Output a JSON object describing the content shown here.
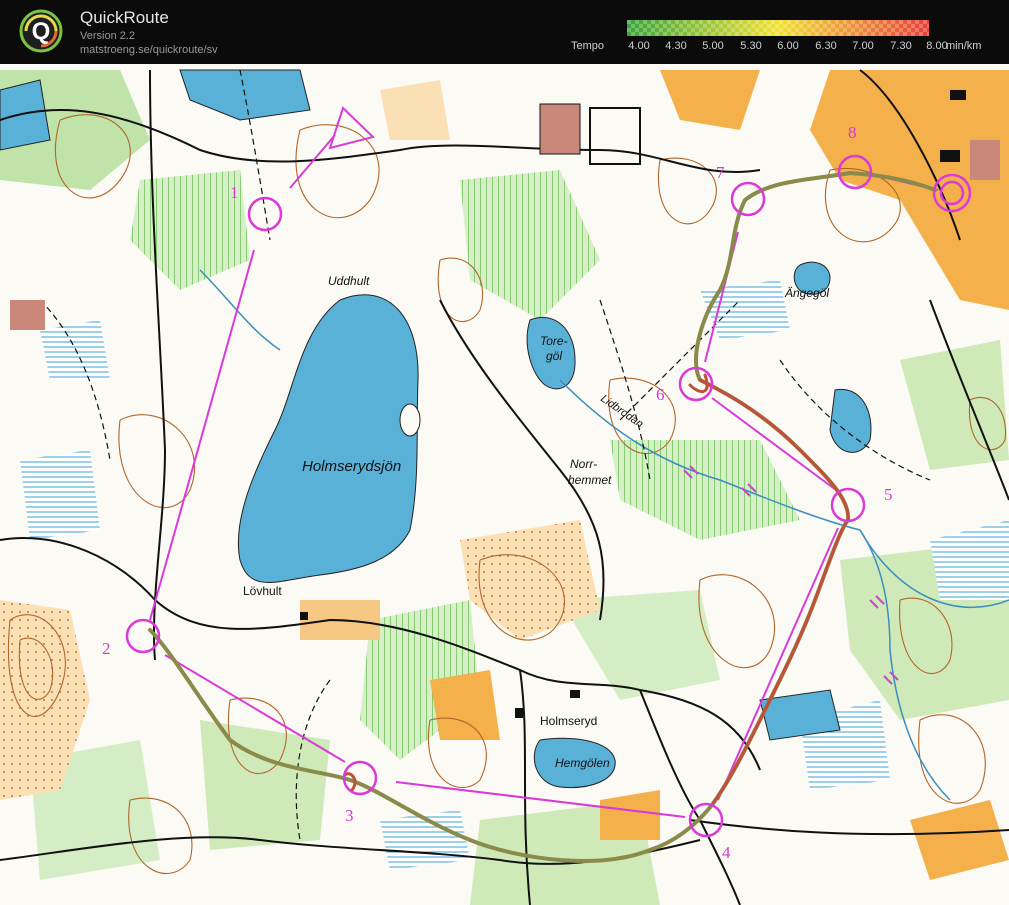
{
  "app": {
    "name": "QuickRoute",
    "version": "Version 2.2",
    "url": "matstroeng.se/quickroute/sv"
  },
  "legend": {
    "label": "Tempo",
    "unit": "min/km",
    "ticks": [
      "4.00",
      "4.30",
      "5.00",
      "5.30",
      "6.00",
      "6.30",
      "7.00",
      "7.30",
      "8.00"
    ],
    "colors": {
      "fast": "#3aa53a",
      "mid": "#f2e234",
      "slow": "#e6403a"
    }
  },
  "map": {
    "place_names": {
      "lake_main": "Holmserydsjön",
      "uddhult": "Uddhult",
      "lovhult": "Lövhult",
      "toregol_1": "Tore-",
      "toregol_2": "göl",
      "lidbrodan": "Lidbrodan",
      "norr_1": "Norr-",
      "norr_2": "hemmet",
      "holmseryd": "Holmseryd",
      "hemgolen": "Hemgölen",
      "angegol": "Ängegöl"
    },
    "controls": [
      "1",
      "2",
      "3",
      "4",
      "5",
      "6",
      "7",
      "8"
    ],
    "colors": {
      "course": "#d93ad9",
      "route": "#c0503c",
      "water": "#5ab1d8",
      "open": "#f4b04a",
      "green": "#a9d98f",
      "contour": "#b0662a",
      "track": "#111111"
    }
  }
}
